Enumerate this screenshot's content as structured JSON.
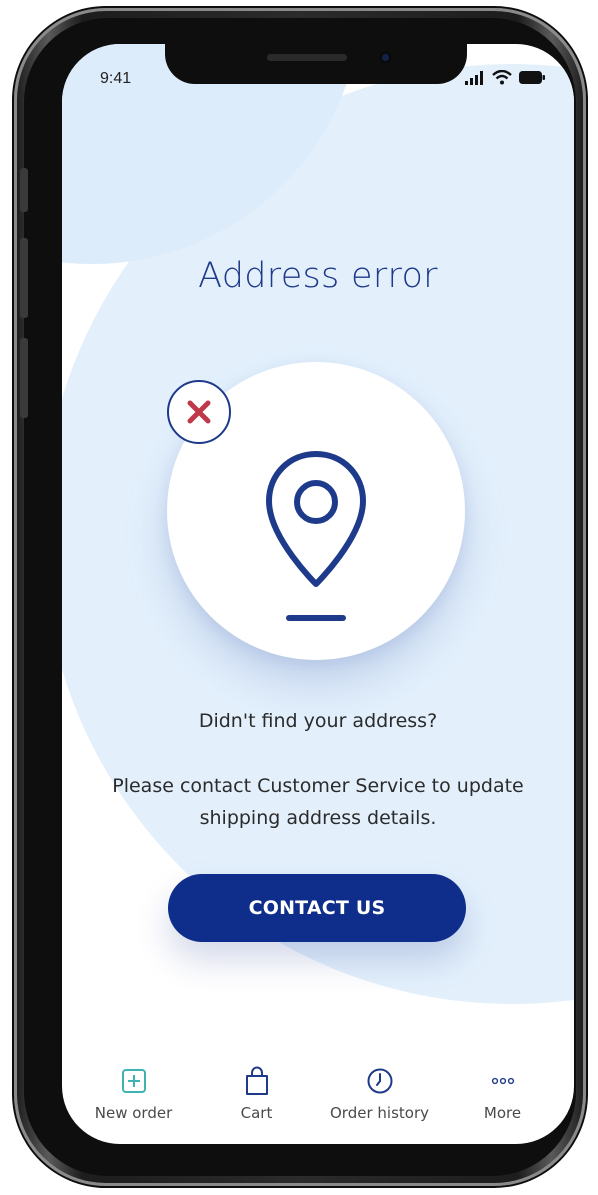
{
  "status_bar": {
    "time": "9:41"
  },
  "main": {
    "title": "Address error",
    "question": "Didn't find your address?",
    "detail": "Please contact Customer Service to update shipping address details.",
    "contact_button_label": "CONTACT US"
  },
  "tab_bar": {
    "items": [
      {
        "label": "New order",
        "icon": "plus-square-icon"
      },
      {
        "label": "Cart",
        "icon": "shopping-bag-icon"
      },
      {
        "label": "Order history",
        "icon": "clock-icon"
      },
      {
        "label": "More",
        "icon": "more-dots-icon"
      }
    ]
  },
  "colors": {
    "brand_navy": "#0f2d8a",
    "title_blue": "#1e3a8a",
    "error_red": "#c0394b",
    "teal_accent": "#3fb3b0",
    "background_tint": "#e3f0fc"
  }
}
